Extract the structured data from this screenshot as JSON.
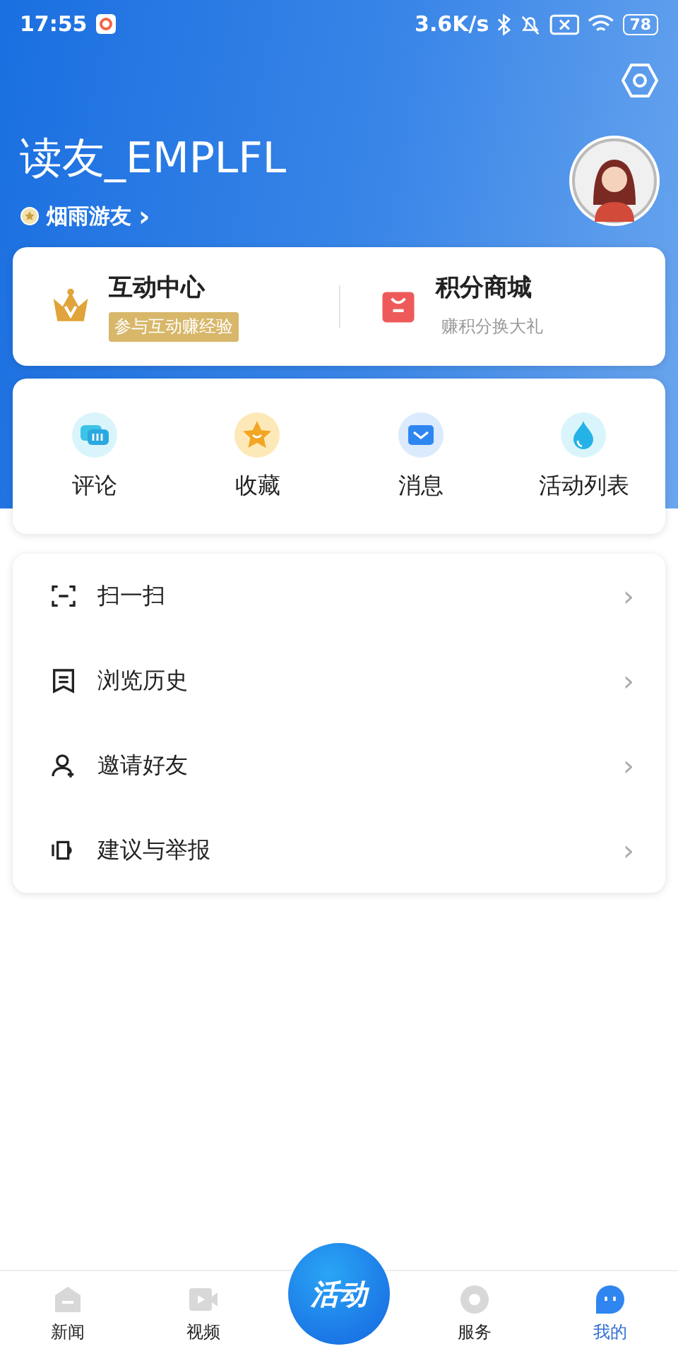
{
  "status_bar": {
    "time": "17:55",
    "speed": "3.6K/s",
    "battery": "78"
  },
  "profile": {
    "name": "读友_EMPLFL",
    "level": "烟雨游友",
    "chevron": "›"
  },
  "feature_cards": [
    {
      "kind": "crown",
      "title": "互动中心",
      "subtitle": "参与互动赚经验"
    },
    {
      "kind": "shop",
      "title": "积分商城",
      "subtitle": "赚积分换大礼"
    }
  ],
  "shortcuts": [
    {
      "kind": "comment",
      "label": "评论"
    },
    {
      "kind": "star",
      "label": "收藏"
    },
    {
      "kind": "mail",
      "label": "消息"
    },
    {
      "kind": "drop",
      "label": "活动列表"
    }
  ],
  "menu": [
    {
      "kind": "scan",
      "label": "扫一扫",
      "chevron": "›"
    },
    {
      "kind": "history",
      "label": "浏览历史",
      "chevron": "›"
    },
    {
      "kind": "invite",
      "label": "邀请好友",
      "chevron": "›"
    },
    {
      "kind": "report",
      "label": "建议与举报",
      "chevron": "›"
    }
  ],
  "tabs": [
    {
      "kind": "news",
      "label": "新闻",
      "selected": false
    },
    {
      "kind": "video",
      "label": "视频",
      "selected": false
    },
    {
      "kind": "center",
      "label": "活动",
      "selected": false
    },
    {
      "kind": "service",
      "label": "服务",
      "selected": false
    },
    {
      "kind": "me",
      "label": "我的",
      "selected": true
    }
  ]
}
